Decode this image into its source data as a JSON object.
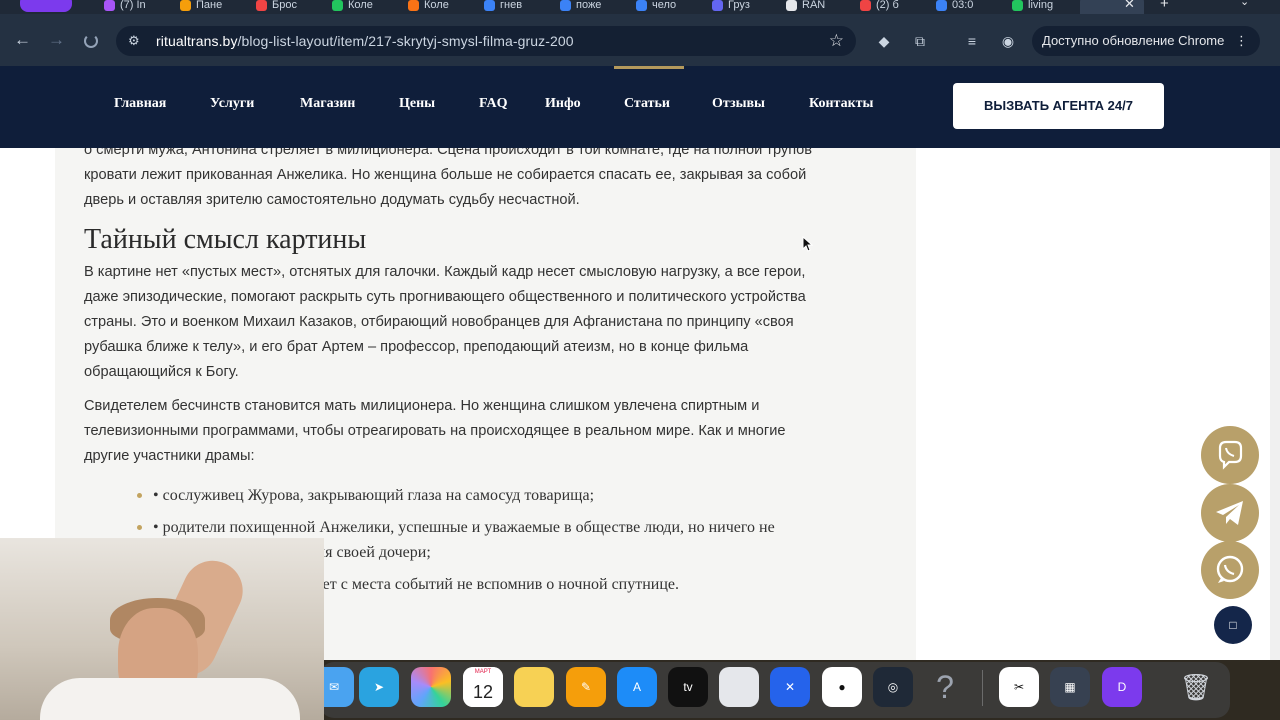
{
  "browser": {
    "tabs": [
      {
        "label": "(7) In",
        "color": "#a855f7"
      },
      {
        "label": "Пане",
        "color": "#f59e0b"
      },
      {
        "label": "Брос",
        "color": "#ef4444"
      },
      {
        "label": "Коле",
        "color": "#22c55e"
      },
      {
        "label": "Коле",
        "color": "#f97316"
      },
      {
        "label": "гнев",
        "color": "#3b82f6"
      },
      {
        "label": "поже",
        "color": "#3b82f6"
      },
      {
        "label": "чело",
        "color": "#3b82f6"
      },
      {
        "label": "Груз",
        "color": "#6366f1"
      },
      {
        "label": "RAN",
        "color": "#e5e7eb"
      },
      {
        "label": "(2) б",
        "color": "#ef4444"
      },
      {
        "label": "03:0",
        "color": "#3b82f6"
      },
      {
        "label": "living",
        "color": "#22c55e"
      }
    ],
    "new_tab_symbol": "+",
    "url_host": "ritualtrans.by",
    "url_path": "/blog-list-layout/item/217-skrytyj-smysl-filma-gruz-200",
    "update_label": "Доступно обновление Chrome"
  },
  "site": {
    "nav": [
      "Главная",
      "Услуги",
      "Магазин",
      "Цены",
      "FAQ",
      "Инфо",
      "Статьи",
      "Отзывы",
      "Контакты"
    ],
    "cta_label": "ВЫЗВАТЬ АГЕНТА 24/7"
  },
  "article": {
    "intro_lines": [
      "о смерти мужа, Антонина стреляет в милиционера. Сцена происходит в той комнате, где на полной трупов",
      "кровати лежит прикованная Анжелика. Но женщина больше не собирается спасать ее, закрывая за собой",
      "дверь и оставляя зрителю самостоятельно додумать судьбу несчастной."
    ],
    "heading": "Тайный смысл картины",
    "paragraph1_lines": [
      "В картине нет «пустых мест», отснятых для галочки. Каждый кадр несет смысловую нагрузку, а все герои,",
      "даже эпизодические, помогают раскрыть суть прогнивающего общественного и политического устройства",
      "страны. Это и военком Михаил Казаков, отбирающий новобранцев для Афганистана по принципу «своя",
      "рубашка ближе к телу», и его брат Артем – профессор, преподающий атеизм, но в конце фильма",
      "обращающийся к Богу."
    ],
    "paragraph2_lines": [
      "Свидетелем бесчинств становится мать милиционера. Но женщина слишком увлечена спиртным и",
      "телевизионными программами, чтобы отреагировать на происходящее в реальном мире. Как и многие",
      "другие участники драмы:"
    ],
    "bullets": [
      [
        "• сослуживец Журова, закрывающий глаза на самосуд товарища;"
      ],
      [
        "• родители похищенной Анжелики, успешные и уважаемые в обществе люди, но ничего не",
        "ния своей дочери;"
      ],
      [
        "кает с места событий не вспомнив о ночной спутнице."
      ]
    ]
  },
  "floating": [
    {
      "name": "viber-button",
      "icon": "viber-icon"
    },
    {
      "name": "telegram-button",
      "icon": "telegram-icon"
    },
    {
      "name": "whatsapp-button",
      "icon": "whatsapp-icon"
    }
  ],
  "scroll_top_symbol": "□",
  "dock": {
    "calendar_month": "МАРТ",
    "calendar_day": "12",
    "tv_label": "tv",
    "help_symbol": "?",
    "apps": [
      "mail-icon",
      "telegram-icon",
      "photos-icon",
      "calendar-icon",
      "notes-icon",
      "pages-icon",
      "app-store-icon",
      "apple-tv-icon",
      "iphone-mirroring-icon",
      "xcode-icon",
      "chat-app-icon",
      "obs-icon",
      "help-icon",
      "capcut-icon",
      "calculator-icon",
      "app-icon",
      "trash-icon"
    ]
  },
  "colors": {
    "header_bg": "#0f1e3a",
    "accent_gold": "#b8a06a",
    "article_bg": "#f5f5f3"
  }
}
